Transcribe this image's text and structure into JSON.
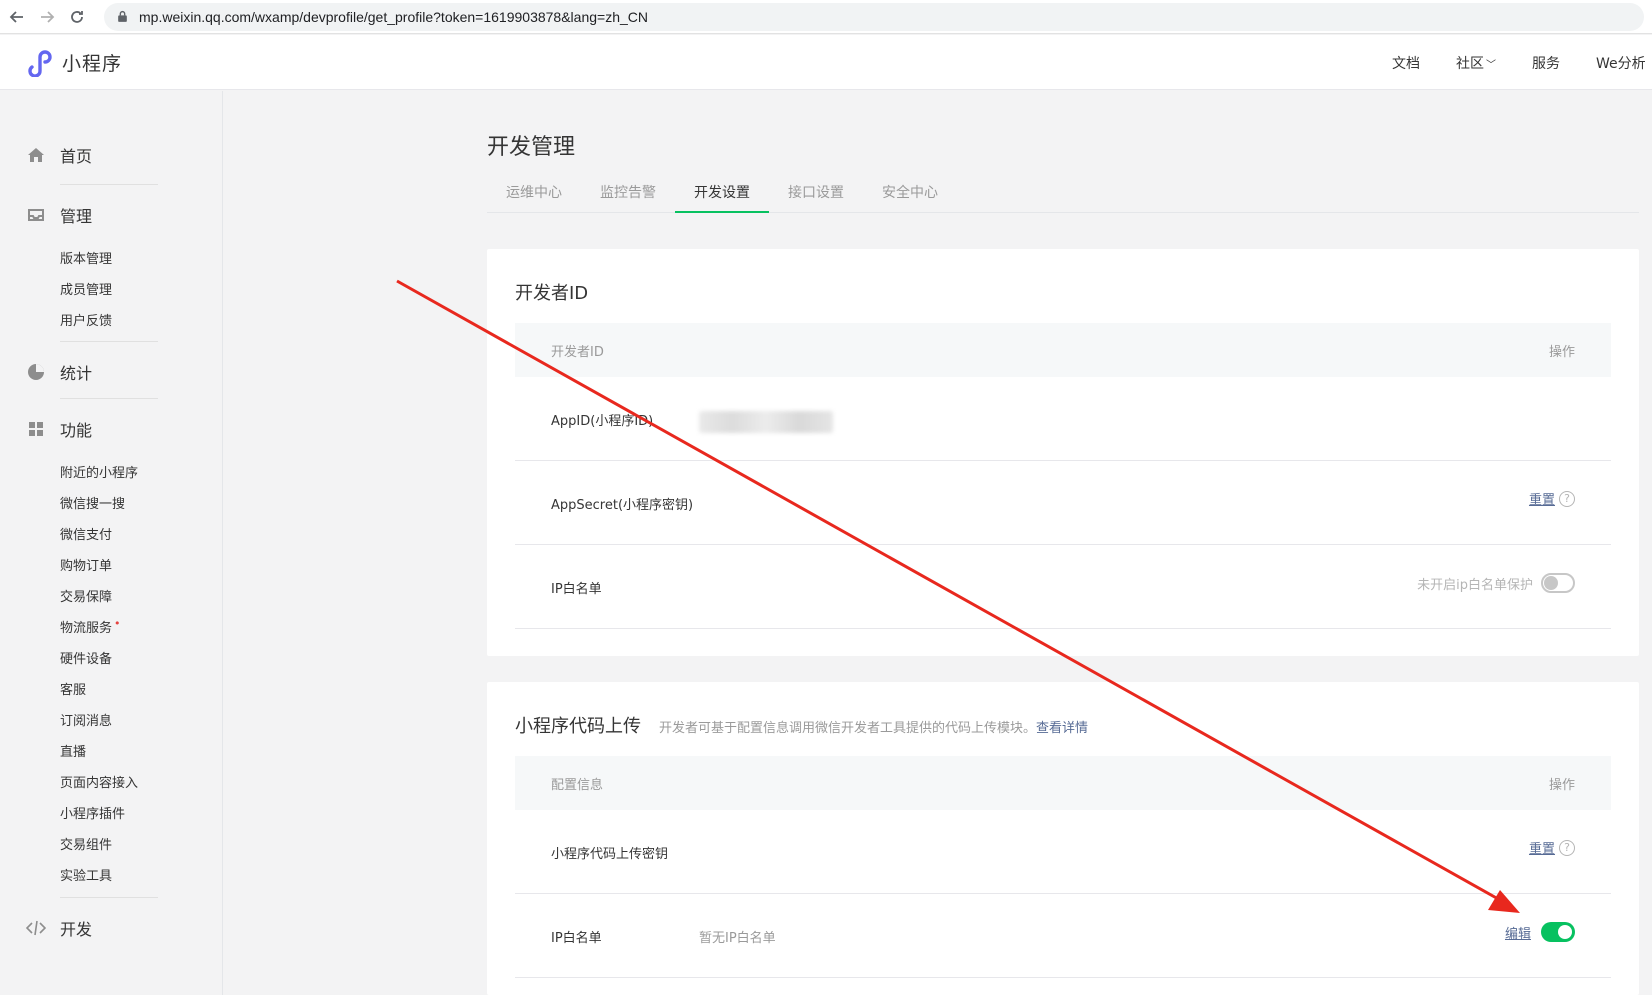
{
  "browser": {
    "url": "mp.weixin.qq.com/wxamp/devprofile/get_profile?token=1619903878&lang=zh_CN"
  },
  "header": {
    "app_name": "小程序",
    "nav": [
      "文档",
      "社区",
      "服务",
      "We分析"
    ]
  },
  "sidebar": {
    "home": "首页",
    "manage": {
      "label": "管理",
      "items": [
        "版本管理",
        "成员管理",
        "用户反馈"
      ]
    },
    "stats": "统计",
    "features": {
      "label": "功能",
      "items": [
        "附近的小程序",
        "微信搜一搜",
        "微信支付",
        "购物订单",
        "交易保障",
        "物流服务",
        "硬件设备",
        "客服",
        "订阅消息",
        "直播",
        "页面内容接入",
        "小程序插件",
        "交易组件",
        "实验工具"
      ]
    },
    "develop": "开发",
    "dot": "•"
  },
  "main": {
    "title": "开发管理",
    "tabs": [
      "运维中心",
      "监控告警",
      "开发设置",
      "接口设置",
      "安全中心"
    ],
    "active_tab": "开发设置",
    "dev_id_card": {
      "title": "开发者ID",
      "col_left": "开发者ID",
      "col_right": "操作",
      "rows": [
        {
          "label": "AppID(小程序ID)"
        },
        {
          "label": "AppSecret(小程序密钥)",
          "action": "重置"
        },
        {
          "label": "IP白名单",
          "status": "未开启ip白名单保护",
          "toggle": false
        }
      ]
    },
    "upload_card": {
      "title": "小程序代码上传",
      "desc": "开发者可基于配置信息调用微信开发者工具提供的代码上传模块。",
      "desc_link": "查看详情",
      "col_left": "配置信息",
      "col_right": "操作",
      "rows": [
        {
          "label": "小程序代码上传密钥",
          "action": "重置"
        },
        {
          "label": "IP白名单",
          "value": "暂无IP白名单",
          "action": "编辑",
          "toggle": true
        }
      ]
    },
    "help_glyph": "?"
  },
  "colors": {
    "accent_green": "#07c160",
    "link_blue": "#576b95",
    "arrow_red": "#e8281e"
  }
}
